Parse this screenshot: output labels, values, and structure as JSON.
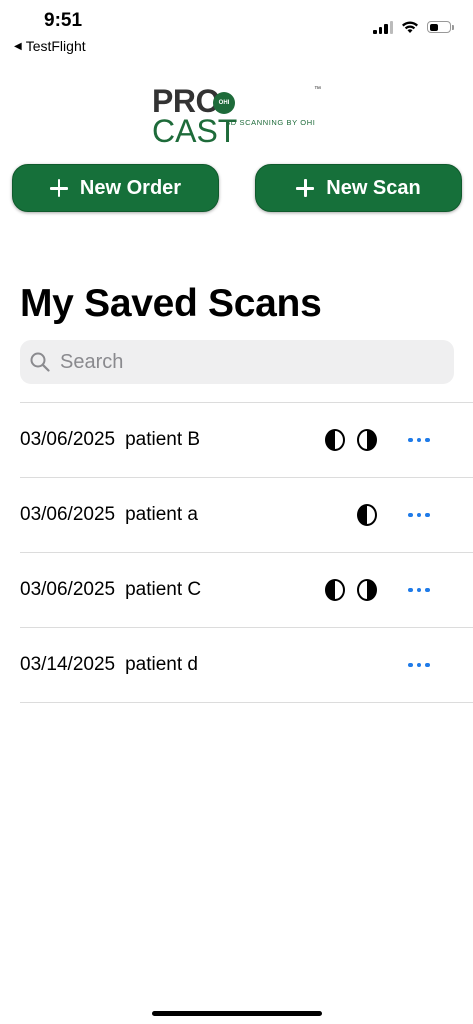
{
  "status_bar": {
    "time": "9:51",
    "back_app": "TestFlight"
  },
  "logo": {
    "brand_left": "PRO",
    "brand_right": "CAST",
    "badge": "OHI",
    "tm": "™",
    "tagline": "3D SCANNING BY OHI"
  },
  "actions": {
    "new_order": "New Order",
    "new_scan": "New Scan"
  },
  "section_title": "My Saved Scans",
  "search": {
    "placeholder": "Search",
    "value": ""
  },
  "scans": [
    {
      "date": "03/06/2025",
      "name": "patient B",
      "arches": [
        "upper",
        "lower"
      ]
    },
    {
      "date": "03/06/2025",
      "name": "patient a",
      "arches": [
        "upper"
      ]
    },
    {
      "date": "03/06/2025",
      "name": "patient C",
      "arches": [
        "upper",
        "lower"
      ]
    },
    {
      "date": "03/14/2025",
      "name": "patient d",
      "arches": []
    }
  ],
  "colors": {
    "brand_green": "#16703a",
    "link_blue": "#1f7be9"
  }
}
